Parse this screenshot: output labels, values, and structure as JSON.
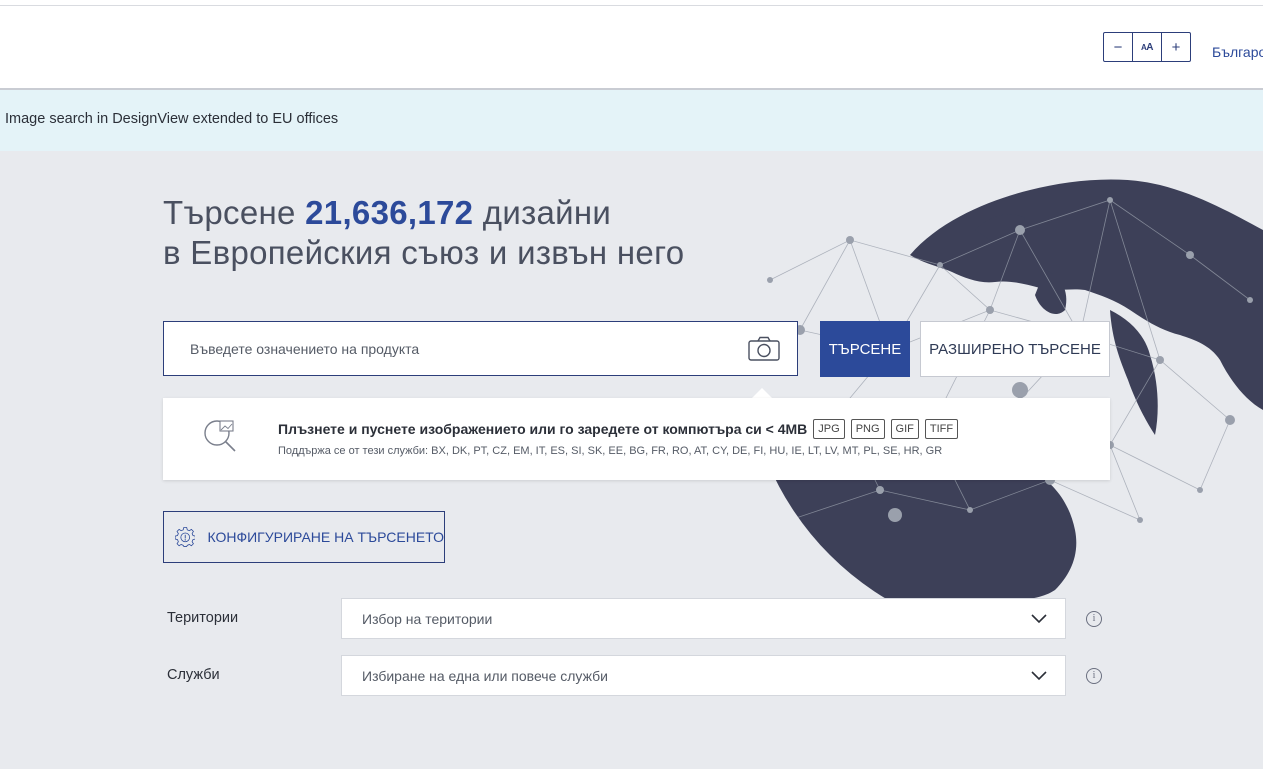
{
  "header": {
    "font_decrease": "−",
    "font_reset": "AA",
    "font_increase": "+",
    "language": "Българо"
  },
  "banner": {
    "text": "Image search in DesignView extended to EU offices"
  },
  "hero": {
    "line1_prefix": "Търсене ",
    "count": "21,636,172",
    "line1_suffix": " дизайни",
    "line2": "в Европейския съюз и извън него"
  },
  "search": {
    "placeholder": "Въведете означението на продукта",
    "camera_icon": "camera-icon",
    "search_button": "ТЪРСЕНЕ",
    "advanced_button": "РАЗШИРЕНО ТЪРСЕНЕ"
  },
  "image_drop": {
    "main_text": "Плъзнете и пуснете изображението или го заредете от компютъра си < 4MB",
    "formats": [
      "JPG",
      "PNG",
      "GIF",
      "TIFF"
    ],
    "support_text": "Поддържа се от тези служби: BX, DK, PT, CZ, EM, IT, ES, SI, SK, EE, BG, FR, RO, AT, CY, DE, FI, HU, IE, LT, LV, MT, PL, SE, HR, GR",
    "icon": "image-search-icon"
  },
  "config": {
    "label": "КОНФИГУРИРАНЕ НА ТЪРСЕНЕТО",
    "icon": "gear-icon"
  },
  "filters": {
    "territories": {
      "label": "Територии",
      "value": "Избор на територии"
    },
    "offices": {
      "label": "Служби",
      "value": "Избиране на една или повече служби"
    }
  },
  "colors": {
    "brand": "#2c4a9a",
    "globe_land": "#3d4058",
    "banner": "#e4f3f8",
    "background": "#e8eaee"
  }
}
